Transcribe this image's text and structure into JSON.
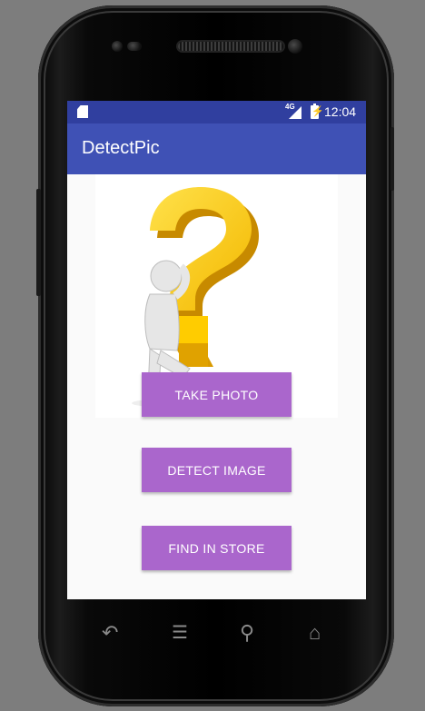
{
  "status_bar": {
    "network": "4G",
    "time": "12:04",
    "icons": [
      "sd-card-icon",
      "signal-icon",
      "battery-icon"
    ]
  },
  "app": {
    "title": "DetectPic"
  },
  "buttons": {
    "take_photo": "TAKE PHOTO",
    "detect_image": "DETECT IMAGE",
    "find_in_store": "FIND IN STORE"
  },
  "nav": {
    "icons": [
      "back-icon",
      "menu-icon",
      "search-icon",
      "home-icon"
    ]
  },
  "colors": {
    "status_bar": "#303F9F",
    "app_bar": "#3F51B5",
    "button": "#AA66CC",
    "question_mark": "#FFD200"
  }
}
